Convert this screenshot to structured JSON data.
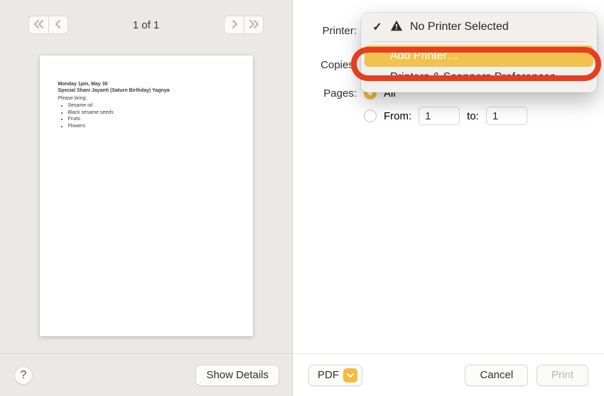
{
  "preview": {
    "page_count_label": "1 of 1",
    "document": {
      "line1": "Monday 1pm, May 30",
      "line2": "Special Shani Jayanti (Saturn Birthday) Yagnya",
      "line3": "Please bring:",
      "items": [
        "Sesame oil",
        "Black sesame seeds",
        "Fruits",
        "Flowers"
      ]
    }
  },
  "left_footer": {
    "help_label": "?",
    "show_details_label": "Show Details"
  },
  "form": {
    "printer_label": "Printer:",
    "copies_label": "Copies:",
    "pages_label": "Pages:",
    "pages_all_label": "All",
    "pages_from_label": "From:",
    "pages_to_label": "to:",
    "pages_from_value": "1",
    "pages_to_value": "1"
  },
  "dropdown": {
    "selected_label": "No Printer Selected",
    "add_printer_label": "Add Printer…",
    "prefs_label": "Printers & Scanners Preferences…"
  },
  "right_footer": {
    "pdf_label": "PDF",
    "cancel_label": "Cancel",
    "print_label": "Print"
  }
}
